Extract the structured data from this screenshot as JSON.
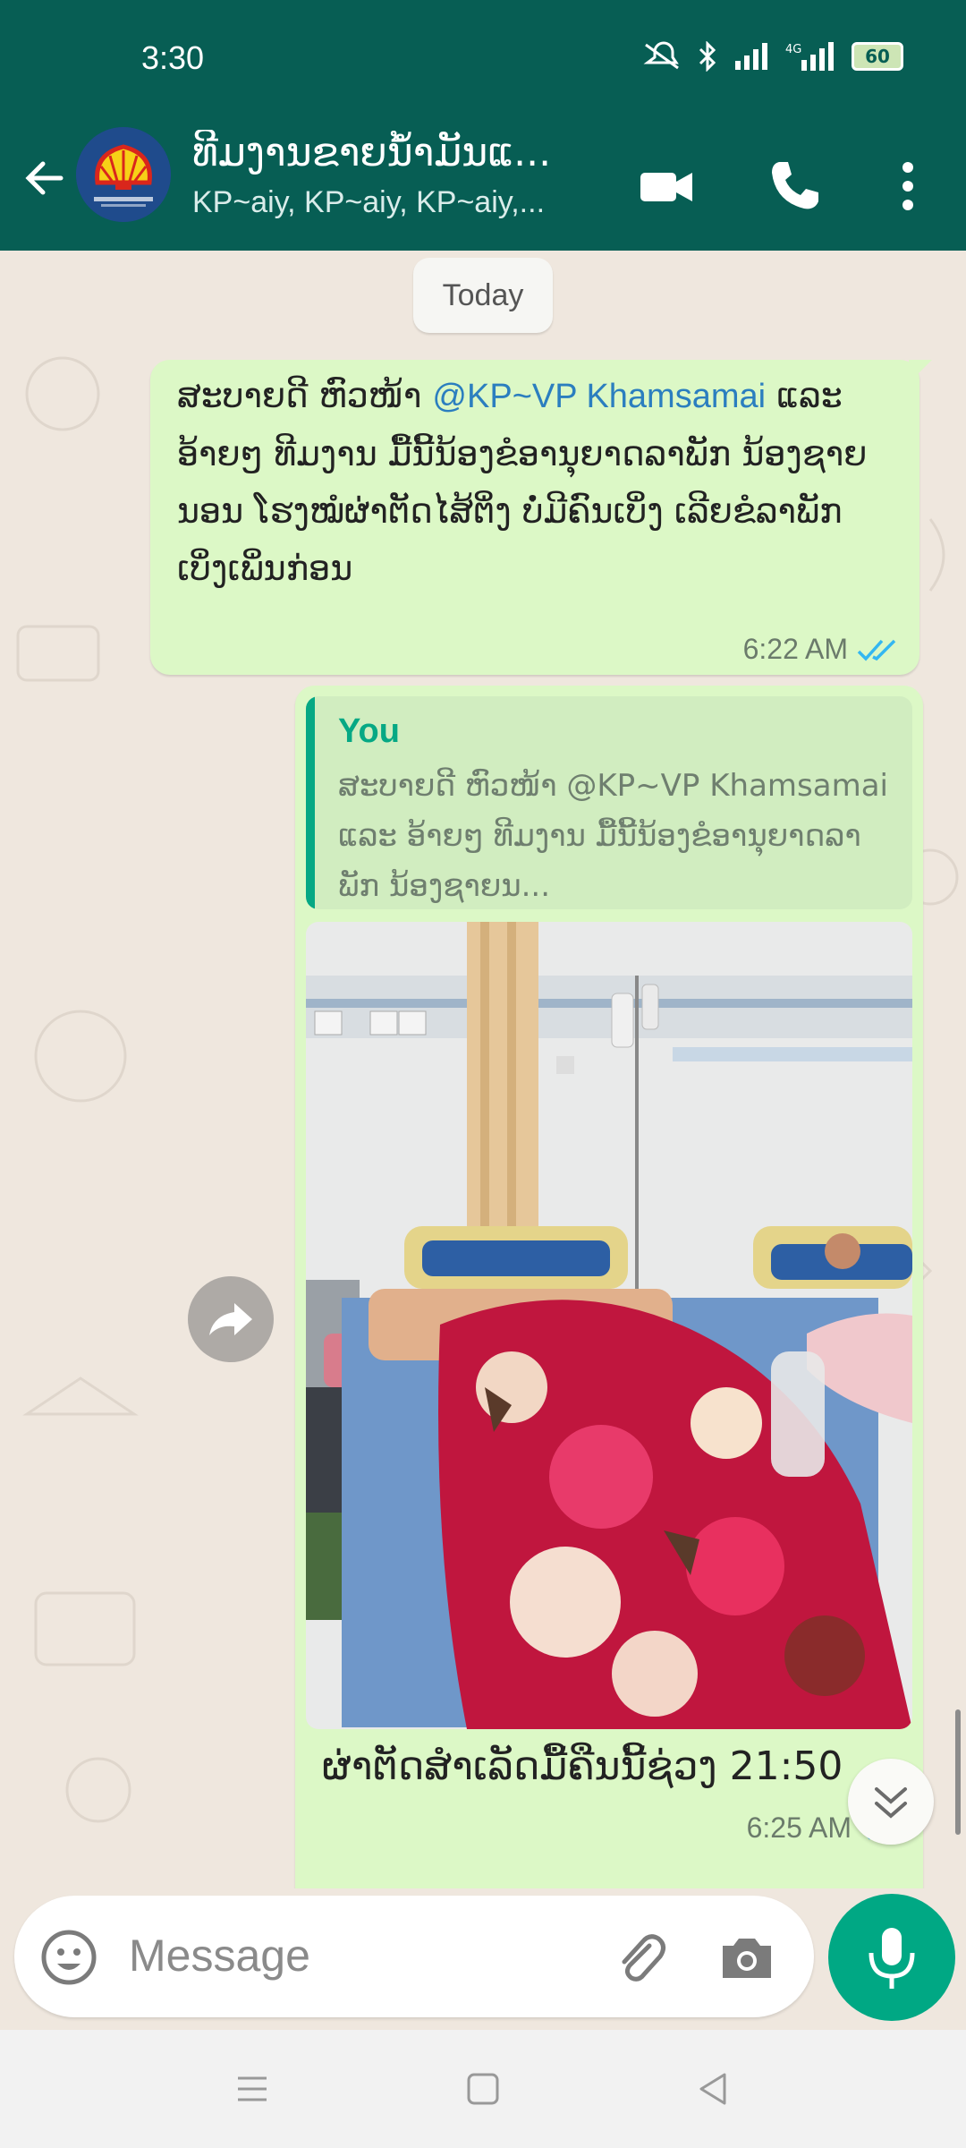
{
  "status_bar": {
    "time": "3:30",
    "battery": "60"
  },
  "header": {
    "title": "ທີມງານຂາຍນ້ຳມັນແ...",
    "subtitle": "KP~aiy, KP~aiy, KP~aiy,..."
  },
  "chat": {
    "date_chip": "Today",
    "messages": [
      {
        "type": "text",
        "text_start": "ສະບາຍດີ ຫົວໜ້າ ",
        "mention": "@KP~VP Khamsamai",
        "text_rest": " ແລະ ອ້າຍໆ ທີມງານ ມື້ນີ້ນ້ອງຂໍອານຸຍາດລາພັກ ນ້ອງຊາຍນອນ ໂຮງໝໍຜ່າຕັດໄສ້ຕິ່ງ ບໍ່ມີຄົນເບິ່ງ ເລີຍຂໍລາພັກ ເບິ່ງເພິ່ນກ່ອນ",
        "time": "6:22 AM"
      },
      {
        "type": "image_reply",
        "quote_author": "You",
        "quote_text": "ສະບາຍດີ ຫົວໜ້າ @KP~VP Khamsamai  ແລະ ອ້າຍໆ ທີມງານ ມື້ນີ້ນ້ອງຂໍອານຸຍາດລາພັກ ນ້ອງຊາຍນ...",
        "caption": "ຜ່າຕັດສຳເລັດມື້ຄືນນີ້ຊ່ວງ 21:50",
        "time": "6:25 AM"
      }
    ]
  },
  "composer": {
    "placeholder": "Message"
  },
  "icons": {
    "back": "arrow-left-icon",
    "video": "video-call-icon",
    "call": "phone-icon",
    "menu": "more-vert-icon",
    "emoji": "emoji-icon",
    "attach": "paperclip-icon",
    "camera": "camera-icon",
    "mic": "mic-icon",
    "forward": "forward-icon",
    "scroll": "chevron-double-down-icon"
  },
  "colors": {
    "header": "#075e54",
    "outgoing_bubble": "#dcf8c6",
    "accent": "#00a884",
    "read_ticks": "#34b7f1"
  }
}
